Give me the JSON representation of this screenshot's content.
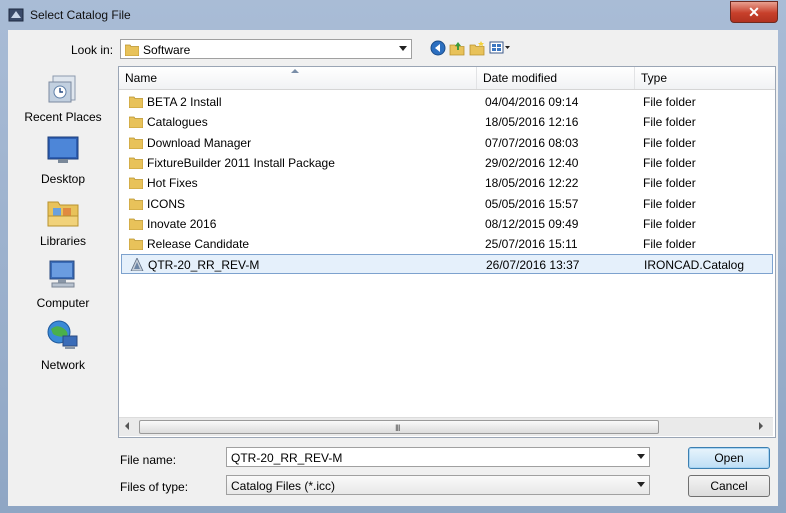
{
  "window": {
    "title": "Select Catalog File",
    "close_label": "✕"
  },
  "lookin": {
    "label": "Look in:",
    "value": "Software"
  },
  "places": [
    {
      "label": "Recent Places",
      "icon": "recent-places-icon"
    },
    {
      "label": "Desktop",
      "icon": "desktop-icon"
    },
    {
      "label": "Libraries",
      "icon": "libraries-icon"
    },
    {
      "label": "Computer",
      "icon": "computer-icon"
    },
    {
      "label": "Network",
      "icon": "network-icon"
    }
  ],
  "columns": {
    "name": "Name",
    "date": "Date modified",
    "type": "Type"
  },
  "files": [
    {
      "name": "BETA 2 Install",
      "date": "04/04/2016 09:14",
      "type": "File folder",
      "icon": "folder-icon"
    },
    {
      "name": "Catalogues",
      "date": "18/05/2016 12:16",
      "type": "File folder",
      "icon": "folder-icon"
    },
    {
      "name": "Download Manager",
      "date": "07/07/2016 08:03",
      "type": "File folder",
      "icon": "folder-icon"
    },
    {
      "name": "FixtureBuilder 2011 Install Package",
      "date": "29/02/2016 12:40",
      "type": "File folder",
      "icon": "folder-icon"
    },
    {
      "name": "Hot Fixes",
      "date": "18/05/2016 12:22",
      "type": "File folder",
      "icon": "folder-icon"
    },
    {
      "name": "ICONS",
      "date": "05/05/2016 15:57",
      "type": "File folder",
      "icon": "folder-icon"
    },
    {
      "name": "Inovate 2016",
      "date": "08/12/2015 09:49",
      "type": "File folder",
      "icon": "folder-icon"
    },
    {
      "name": "Release Candidate",
      "date": "25/07/2016 15:11",
      "type": "File folder",
      "icon": "folder-icon"
    },
    {
      "name": "QTR-20_RR_REV-M",
      "date": "26/07/2016 13:37",
      "type": "IRONCAD.Catalog",
      "icon": "catalog-file-icon",
      "selected": true
    }
  ],
  "filename": {
    "label": "File name:",
    "value": "QTR-20_RR_REV-M"
  },
  "filetype": {
    "label": "Files of type:",
    "value": "Catalog Files (*.icc)"
  },
  "buttons": {
    "open": "Open",
    "cancel": "Cancel"
  },
  "scrollbar": {
    "grip": "III"
  },
  "colors": {
    "folder": "#e8c25a",
    "selection": "#e5f0fb",
    "selection_border": "#7da2ce"
  }
}
